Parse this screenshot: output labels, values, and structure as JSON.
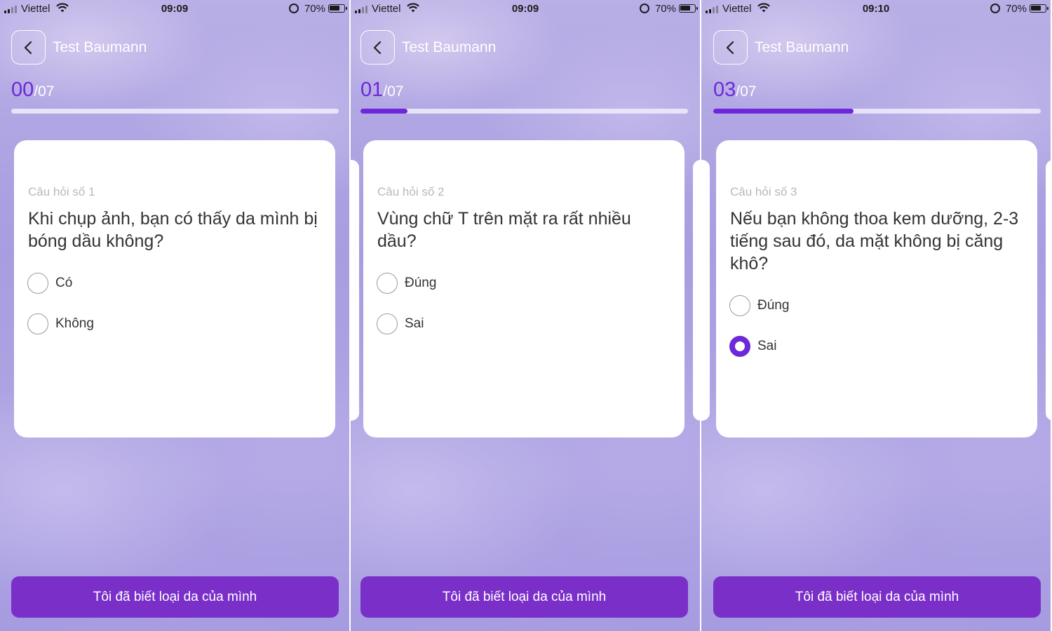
{
  "colors": {
    "accent": "#6d28d9",
    "button": "#7a2fc9",
    "card": "#ffffff"
  },
  "icons": {
    "back": "chevron-left-icon",
    "wifi": "wifi-icon",
    "signal": "cellular-signal-icon",
    "battery": "battery-icon",
    "rotation_lock": "rotation-lock-icon"
  },
  "screens": [
    {
      "status": {
        "carrier": "Viettel",
        "time": "09:09",
        "battery": "70%"
      },
      "header": {
        "title": "Test Baumann"
      },
      "progress": {
        "current": "00",
        "total": "/07",
        "fraction": 0
      },
      "question": {
        "number_label": "Câu hỏi số 1",
        "text": "Khi chụp ảnh, bạn có thấy da mình bị bóng dầu không?"
      },
      "options": [
        {
          "label": "Có",
          "selected": false
        },
        {
          "label": "Không",
          "selected": false
        }
      ],
      "cta_label": "Tôi đã biết loại da của mình"
    },
    {
      "status": {
        "carrier": "Viettel",
        "time": "09:09",
        "battery": "70%"
      },
      "header": {
        "title": "Test Baumann"
      },
      "progress": {
        "current": "01",
        "total": "/07",
        "fraction": 0.143
      },
      "question": {
        "number_label": "Câu hỏi số 2",
        "text": "Vùng chữ T trên mặt ra rất nhiều dầu?"
      },
      "options": [
        {
          "label": "Đúng",
          "selected": false
        },
        {
          "label": "Sai",
          "selected": false
        }
      ],
      "cta_label": "Tôi đã biết loại da của mình"
    },
    {
      "status": {
        "carrier": "Viettel",
        "time": "09:10",
        "battery": "70%"
      },
      "header": {
        "title": "Test Baumann"
      },
      "progress": {
        "current": "03",
        "total": "/07",
        "fraction": 0.429
      },
      "question": {
        "number_label": "Câu hỏi số 3",
        "text": "Nếu bạn không thoa kem dưỡng, 2-3 tiếng sau đó, da mặt không bị căng khô?"
      },
      "options": [
        {
          "label": "Đúng",
          "selected": false
        },
        {
          "label": "Sai",
          "selected": true
        }
      ],
      "cta_label": "Tôi đã biết loại da của mình"
    }
  ]
}
